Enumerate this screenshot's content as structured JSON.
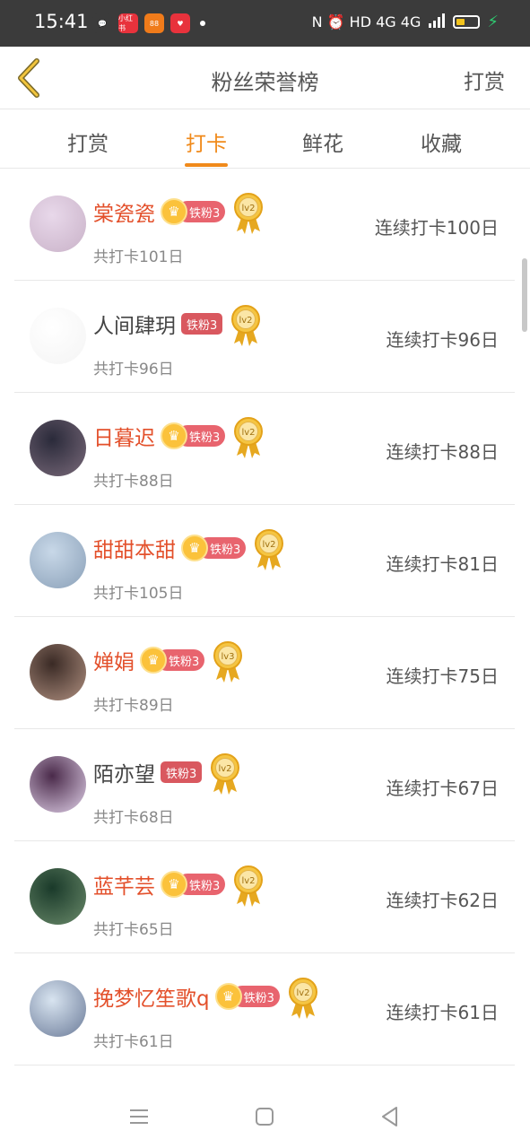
{
  "status_bar": {
    "time": "15:41",
    "right_text": "N ⏰ HD 4G 4G",
    "app_icons": [
      {
        "name": "wechat-icon",
        "color": "#3b3b3b",
        "glyph": "💬"
      },
      {
        "name": "xiaohongshu-icon",
        "color": "#e8323c",
        "glyph": "小红书"
      },
      {
        "name": "app-orange-icon",
        "color": "#f07b1a",
        "glyph": "88"
      },
      {
        "name": "app-red-icon",
        "color": "#e8323c",
        "glyph": "♥"
      }
    ]
  },
  "header": {
    "title": "粉丝荣誉榜",
    "action_label": "打赏"
  },
  "tabs": [
    {
      "label": "打赏",
      "active": false
    },
    {
      "label": "打卡",
      "active": true
    },
    {
      "label": "鲜花",
      "active": false
    },
    {
      "label": "收藏",
      "active": false
    }
  ],
  "fans": [
    {
      "name": "棠瓷瓷",
      "vip": true,
      "badge": "铁粉3",
      "level": "lv2",
      "total": "共打卡101日",
      "streak": "连续打卡100日",
      "avatar_colors": [
        "#e8d8ea",
        "#c9b2c8"
      ]
    },
    {
      "name": "人间肆玥",
      "vip": false,
      "badge": "铁粉3",
      "level": "lv2",
      "total": "共打卡96日",
      "streak": "连续打卡96日",
      "avatar_colors": [
        "#ffffff",
        "#f4f4f4"
      ]
    },
    {
      "name": "日暮迟",
      "vip": true,
      "badge": "铁粉3",
      "level": "lv2",
      "total": "共打卡88日",
      "streak": "连续打卡88日",
      "avatar_colors": [
        "#2a2a3a",
        "#7a6a7a"
      ]
    },
    {
      "name": "甜甜本甜",
      "vip": true,
      "badge": "铁粉3",
      "level": "lv2",
      "total": "共打卡105日",
      "streak": "连续打卡81日",
      "avatar_colors": [
        "#c8d8e8",
        "#8aa0b8"
      ]
    },
    {
      "name": "婵娟",
      "vip": true,
      "badge": "铁粉3",
      "level": "lv3",
      "total": "共打卡89日",
      "streak": "连续打卡75日",
      "avatar_colors": [
        "#3a2a25",
        "#b09080"
      ]
    },
    {
      "name": "陌亦望",
      "vip": false,
      "badge": "铁粉3",
      "level": "lv2",
      "total": "共打卡68日",
      "streak": "连续打卡67日",
      "avatar_colors": [
        "#4a2a4a",
        "#e0d0e8"
      ]
    },
    {
      "name": "蓝芊芸",
      "vip": true,
      "badge": "铁粉3",
      "level": "lv2",
      "total": "共打卡65日",
      "streak": "连续打卡62日",
      "avatar_colors": [
        "#1a3a2a",
        "#6a8a6a"
      ]
    },
    {
      "name": "挽梦忆笙歌q",
      "vip": true,
      "badge": "铁粉3",
      "level": "lv2",
      "total": "共打卡61日",
      "streak": "连续打卡61日",
      "avatar_colors": [
        "#d8e4f0",
        "#6a7a98"
      ]
    }
  ],
  "colors": {
    "accent": "#f08a1b",
    "vip_name": "#e3502b",
    "badge": "#e8646e"
  }
}
